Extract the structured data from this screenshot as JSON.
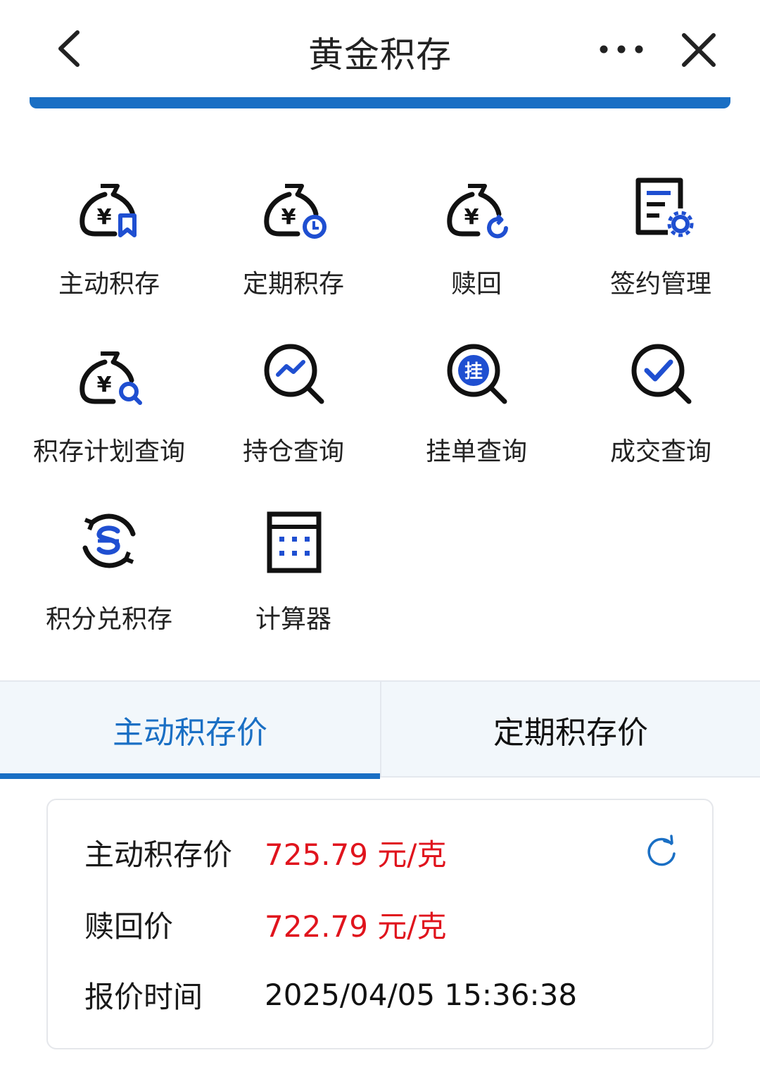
{
  "header": {
    "title": "黄金积存"
  },
  "grid": {
    "items": [
      {
        "label": "主动积存",
        "icon": "money-bag-bookmark-icon"
      },
      {
        "label": "定期积存",
        "icon": "money-bag-clock-icon"
      },
      {
        "label": "赎回",
        "icon": "money-bag-refresh-icon"
      },
      {
        "label": "签约管理",
        "icon": "document-gear-icon"
      },
      {
        "label": "积存计划查询",
        "icon": "money-bag-search-icon"
      },
      {
        "label": "持仓查询",
        "icon": "search-trend-icon"
      },
      {
        "label": "挂单查询",
        "icon": "search-gua-icon"
      },
      {
        "label": "成交查询",
        "icon": "search-check-icon"
      },
      {
        "label": "积分兑积存",
        "icon": "points-exchange-icon"
      },
      {
        "label": "计算器",
        "icon": "calculator-icon"
      }
    ],
    "gua_char": "挂",
    "yen_char": "¥"
  },
  "tabs": [
    {
      "label": "主动积存价",
      "active": true
    },
    {
      "label": "定期积存价",
      "active": false
    }
  ],
  "price_card": {
    "rows": [
      {
        "label": "主动积存价",
        "value": "725.79 元/克"
      },
      {
        "label": "赎回价",
        "value": "722.79 元/克"
      },
      {
        "label": "报价时间",
        "value": "2025/04/05 15:36:38"
      }
    ]
  },
  "colors": {
    "accent": "#1a6fc4",
    "price_red": "#e0141d",
    "icon_dark": "#111111",
    "icon_blue": "#1f4fd1"
  }
}
